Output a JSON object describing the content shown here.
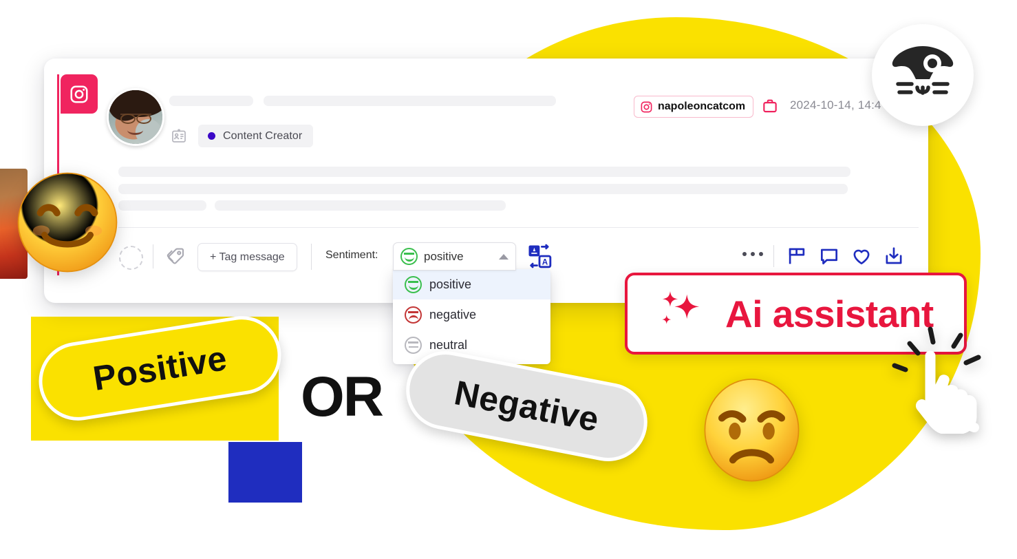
{
  "card": {
    "network_icon": "instagram-icon",
    "avatar_alt": "user-avatar",
    "role": {
      "icon": "contact-card-icon",
      "label": "Content Creator",
      "dot_color": "#3B08C7"
    },
    "account": {
      "icon": "instagram-icon",
      "handle": "napoleoncatcom"
    },
    "post": {
      "icon": "briefcase-icon",
      "date": "2024-10-14, 14:4"
    }
  },
  "toolbar": {
    "assign_icon": "assign-avatar-placeholder-icon",
    "tag_icon": "tag-icon",
    "tag_button": "+ Tag message",
    "sentiment_label": "Sentiment:",
    "translate_icon": "translate-icon",
    "more_icon": "ellipsis-icon",
    "actions": [
      {
        "icon": "flag-icon"
      },
      {
        "icon": "comment-icon"
      },
      {
        "icon": "heart-icon"
      },
      {
        "icon": "download-icon"
      }
    ]
  },
  "sentiment_select": {
    "selected": "positive",
    "selected_icon": "smiley-positive-icon",
    "caret": "chevron-up-icon",
    "options": [
      {
        "label": "positive",
        "icon": "smiley-positive-icon",
        "color": "#3BBF4E",
        "selected": true
      },
      {
        "label": "negative",
        "icon": "smiley-negative-icon",
        "color": "#C33636",
        "selected": false
      },
      {
        "label": "neutral",
        "icon": "smiley-neutral-icon",
        "color": "#B8B8BE",
        "selected": false
      }
    ]
  },
  "callouts": {
    "positive_pill": "Positive",
    "or_text": "OR",
    "negative_pill": "Negative",
    "ai_badge": {
      "icon": "sparkle-icon",
      "label": "Ai assistant"
    },
    "cursor_icon": "pointer-hand-icon",
    "brand_logo_icon": "napoleoncat-cat-logo-icon",
    "emoji_positive": "smiling-face-with-smiling-eyes-emoji",
    "emoji_negative": "angry-face-emoji"
  },
  "colors": {
    "brand_yellow": "#FAE100",
    "brand_pink": "#F0245F",
    "brand_red": "#E8163E",
    "action_blue": "#1F2DBF",
    "role_purple": "#3B08C7"
  }
}
